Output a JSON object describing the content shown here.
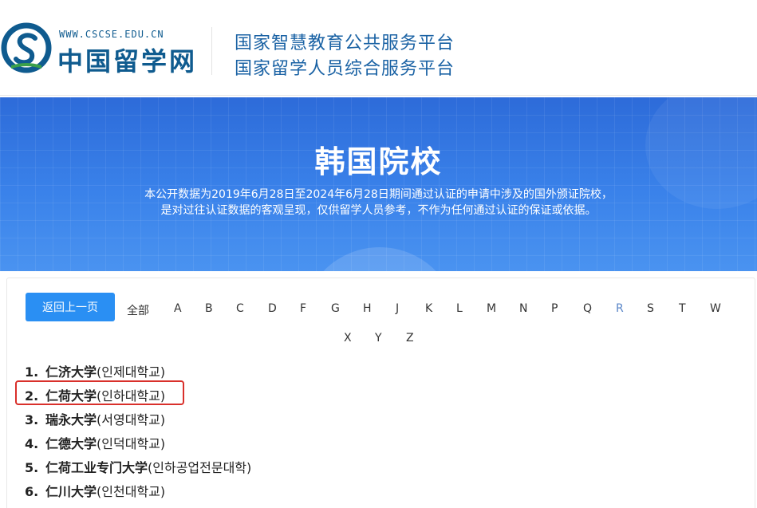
{
  "header": {
    "logo_url_text": "WWW.CSCSE.EDU.CN",
    "logo_name": "中国留学网",
    "platform_line_1": "国家智慧教育公共服务平台",
    "platform_line_2": "国家留学人员综合服务平台",
    "brand_color": "#0f5b8f"
  },
  "banner": {
    "title": "韩国院校",
    "desc_line_1": "本公开数据为2019年6月28日至2024年6月28日期间通过认证的申请中涉及的国外颁证院校，",
    "desc_line_2": "是对过往认证数据的客观呈现，仅供留学人员参考，不作为任何通过认证的保证或依据。"
  },
  "nav": {
    "back_label": "返回上一页",
    "all_label": "全部",
    "letters": [
      "A",
      "B",
      "C",
      "D",
      "F",
      "G",
      "H",
      "J",
      "K",
      "L",
      "M",
      "N",
      "P",
      "Q",
      "R",
      "S",
      "T",
      "W",
      "X",
      "Y",
      "Z"
    ],
    "active_letter": "R"
  },
  "universities": [
    {
      "num": "1.",
      "cn": "仁济大学",
      "kr": "(인제대학교)"
    },
    {
      "num": "2.",
      "cn": "仁荷大学",
      "kr": "(인하대학교)"
    },
    {
      "num": "3.",
      "cn": "瑞永大学",
      "kr": "(서영대학교)"
    },
    {
      "num": "4.",
      "cn": "仁德大学",
      "kr": "(인덕대학교)"
    },
    {
      "num": "5.",
      "cn": "仁荷工业专门大学",
      "kr": "(인하공업전문대학)"
    },
    {
      "num": "6.",
      "cn": "仁川大学",
      "kr": "(인천대학교)"
    }
  ],
  "highlighted_index": 1,
  "colors": {
    "accent": "#2a8ff3",
    "highlight": "#d9302b",
    "banner": "#3a82ea"
  }
}
